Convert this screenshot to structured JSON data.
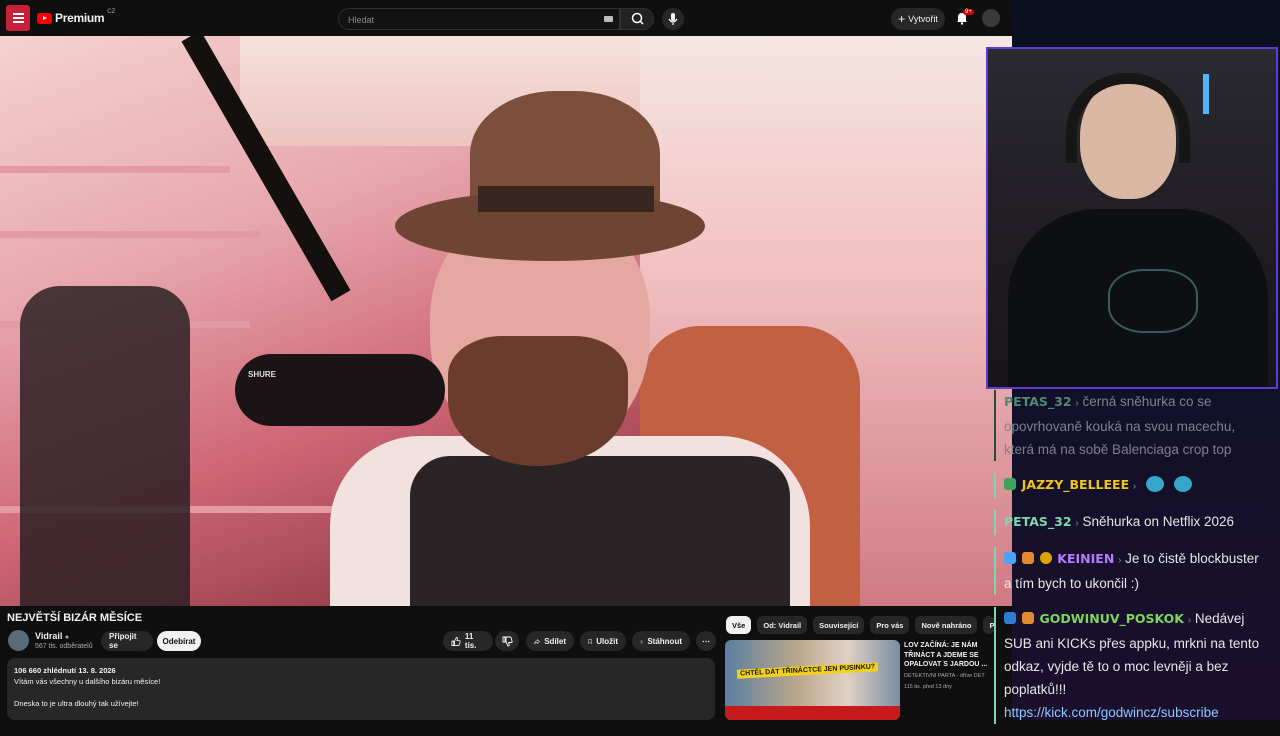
{
  "header": {
    "logo_text": "Premium",
    "logo_region": "CZ",
    "search_placeholder": "Hledat",
    "create_label": "Vytvořit",
    "notification_count": "9+",
    "icons": [
      "menu-icon",
      "search-icon",
      "mic-icon",
      "plus-icon",
      "bell-icon",
      "keyboard-icon"
    ]
  },
  "video": {
    "title": "NEJVĚTŠÍ BIZÁR MĚSÍCE",
    "mic_brand": "SHURE"
  },
  "channel": {
    "name": "Vidrail",
    "subscribers": "567 tis. odběratelů",
    "join_label": "Připojit se",
    "subscribe_label": "Odebírat"
  },
  "actions": {
    "likes": "11 tis.",
    "share": "Sdílet",
    "save": "Uložit",
    "download": "Stáhnout"
  },
  "description": {
    "stats": "106 660 zhlédnutí  13. 8. 2026",
    "line1": "Vítám vás všechny u dalšího bizáru měsíce!",
    "line2": "Dneska to je ultra dlouhý tak užívejte!"
  },
  "related": {
    "chips": [
      "Vše",
      "Od: Vidrail",
      "Související",
      "Pro vás",
      "Nově nahráno",
      "P"
    ],
    "item": {
      "title": "LOV ZAČÍNÁ: JE NÁM TŘINÁCT A JDEME SE OPALOVAT S JARDOU ...",
      "channel": "DETEKTIVNÍ PARTA - dříve DET",
      "meta": "115 tis.  před 13 dny",
      "thumb_text": "CHTĚL DÁT TŘINÁCTCE JEN PUSINKU?"
    }
  },
  "chat": {
    "messages": [
      {
        "user": "PETAS_32",
        "text": "černá sněhurka co se opovrhovaně kouká na svou macechu, která má na sobě Balenciaga crop top",
        "faint": true,
        "color": "#7fd7b0"
      },
      {
        "user": "JAZZY_BELLEEE",
        "text": "",
        "color": "#f0c419"
      },
      {
        "user": "PETAS_32",
        "text": "Sněhurka on Netflix 2026",
        "color": "#7fd7b0"
      },
      {
        "user": "KEINIEN",
        "text": "Je to čistě blockbuster a tím bych to ukončil :)",
        "color": "#b57cff"
      },
      {
        "user": "GODWINUV_POSKOK",
        "text": "Nedávej SUB ani KICKs přes appku, mrkni na tento odkaz, vyjde tě to o moc levněji a bez poplatků!!!",
        "color": "#7dd75b"
      },
      {
        "link": "https://kick.com/godwincz/subscribe"
      }
    ]
  }
}
